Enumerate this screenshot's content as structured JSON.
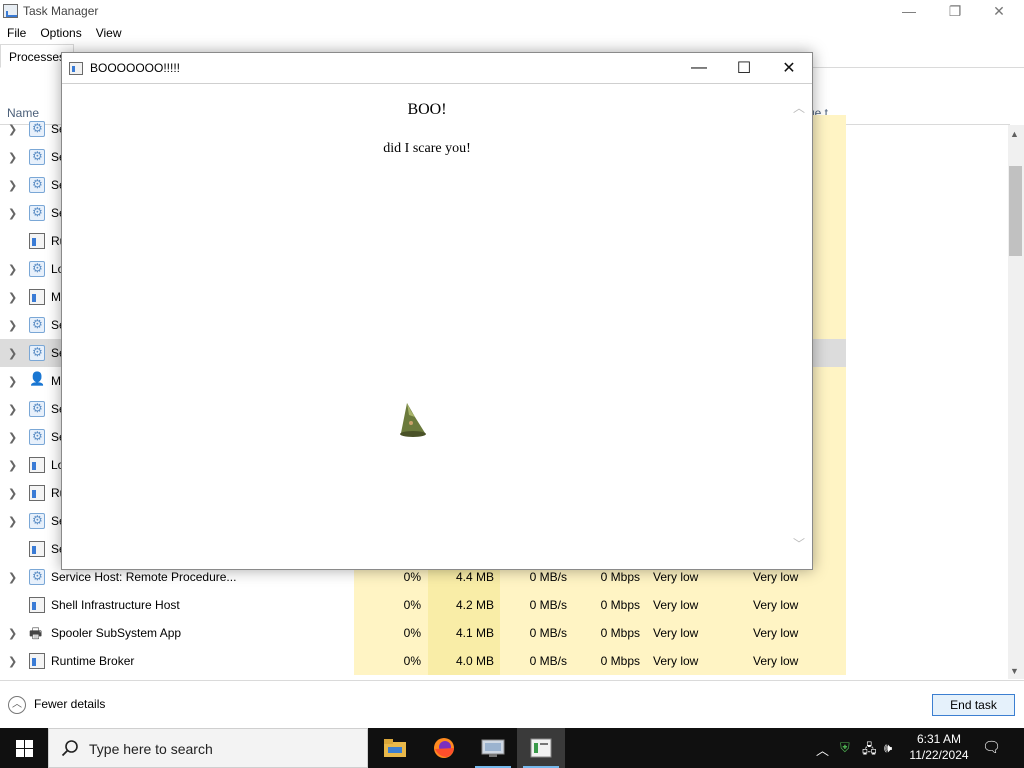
{
  "task_manager": {
    "title": "Task Manager",
    "menu": [
      "File",
      "Options",
      "View"
    ],
    "tabs": [
      "Processes"
    ],
    "columns": {
      "name": "Name",
      "partial_right": "ge t..."
    },
    "rows": [
      {
        "name": "Se",
        "icon": "service-gear-icon",
        "chevron": true
      },
      {
        "name": "Se",
        "icon": "service-gear-icon",
        "chevron": true
      },
      {
        "name": "Se",
        "icon": "service-gear-icon",
        "chevron": true
      },
      {
        "name": "Se",
        "icon": "service-gear-icon",
        "chevron": true
      },
      {
        "name": "Ru",
        "icon": "window-app-icon",
        "chevron": false
      },
      {
        "name": "Lo",
        "icon": "service-gear-icon",
        "chevron": true
      },
      {
        "name": "M",
        "icon": "window-app-icon",
        "chevron": true
      },
      {
        "name": "Se",
        "icon": "service-gear-icon",
        "chevron": true
      },
      {
        "name": "Se",
        "icon": "service-gear-icon",
        "chevron": true,
        "selected": true
      },
      {
        "name": "M",
        "icon": "user-icon",
        "chevron": true
      },
      {
        "name": "Se",
        "icon": "service-gear-icon",
        "chevron": true
      },
      {
        "name": "Se",
        "icon": "service-gear-icon",
        "chevron": true
      },
      {
        "name": "Lo",
        "icon": "window-app-icon",
        "chevron": true
      },
      {
        "name": "Ru",
        "icon": "window-app-icon",
        "chevron": true
      },
      {
        "name": "Se",
        "icon": "service-gear-icon",
        "chevron": true
      },
      {
        "name": "Se",
        "icon": "window-app-icon",
        "chevron": false
      },
      {
        "name": "Service Host: Remote Procedure...",
        "icon": "service-gear-icon",
        "chevron": true,
        "cpu": "0%",
        "memory": "4.4 MB",
        "disk": "0 MB/s",
        "network": "0 Mbps",
        "power": "Very low",
        "power_trend": "Very low"
      },
      {
        "name": "Shell Infrastructure Host",
        "icon": "window-app-icon",
        "chevron": false,
        "cpu": "0%",
        "memory": "4.2 MB",
        "disk": "0 MB/s",
        "network": "0 Mbps",
        "power": "Very low",
        "power_trend": "Very low"
      },
      {
        "name": "Spooler SubSystem App",
        "icon": "printer-icon",
        "chevron": true,
        "cpu": "0%",
        "memory": "4.1 MB",
        "disk": "0 MB/s",
        "network": "0 Mbps",
        "power": "Very low",
        "power_trend": "Very low"
      },
      {
        "name": "Runtime Broker",
        "icon": "window-app-icon",
        "chevron": true,
        "cpu": "0%",
        "memory": "4.0 MB",
        "disk": "0 MB/s",
        "network": "0 Mbps",
        "power": "Very low",
        "power_trend": "Very low"
      }
    ],
    "footer": {
      "fewer_details": "Fewer details",
      "end_task": "End task"
    }
  },
  "popup": {
    "title": "BOOOOOOO!!!!!",
    "heading": "BOO!",
    "message": "did I scare you!"
  },
  "taskbar": {
    "search_placeholder": "Type here to search",
    "time": "6:31 AM",
    "date": "11/22/2024"
  },
  "colors": {
    "highlight_light": "#fff4c4",
    "highlight_dark": "#f9eda7",
    "accent": "#3c7fd1",
    "taskbar": "#101010"
  }
}
